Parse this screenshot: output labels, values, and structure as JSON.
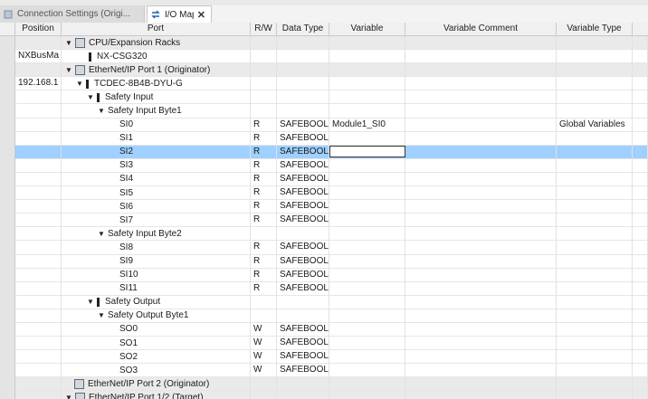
{
  "tabs": [
    {
      "label": "Connection Settings (Origi...",
      "active": false
    },
    {
      "label": "I/O Map",
      "active": true,
      "close": "✕"
    }
  ],
  "columns": {
    "position": "Position",
    "port": "Port",
    "rw": "R/W",
    "type": "Data Type",
    "variable": "Variable",
    "comment": "Variable Comment",
    "vtype": "Variable Type"
  },
  "rows": [
    {
      "position": "",
      "port": "CPU/Expansion Racks",
      "rw": "",
      "type": "",
      "variable": "",
      "vtype": "",
      "group": true,
      "tri": "▼",
      "icon": "rack"
    },
    {
      "position": "NXBusMa",
      "port": "NX-CSG320",
      "rw": "",
      "type": "",
      "variable": "",
      "vtype": "",
      "group": false,
      "tri": "",
      "icon": "device"
    },
    {
      "position": "",
      "port": "EtherNet/IP Port 1 (Originator)",
      "rw": "",
      "type": "",
      "variable": "",
      "vtype": "",
      "group": true,
      "tri": "▼",
      "icon": "rack"
    },
    {
      "position": "192.168.1",
      "port": "TCDEC-8B4B-DYU-G",
      "rw": "",
      "type": "",
      "variable": "",
      "vtype": "",
      "group": false,
      "tri": "▼",
      "icon": "device"
    },
    {
      "position": "",
      "port": "Safety Input",
      "rw": "",
      "type": "",
      "variable": "",
      "vtype": "",
      "group": false,
      "tri": "▼",
      "icon": "device"
    },
    {
      "position": "",
      "port": "Safety Input Byte1",
      "rw": "",
      "type": "",
      "variable": "",
      "vtype": "",
      "group": false,
      "tri": "▼",
      "icon": ""
    },
    {
      "position": "",
      "port": "SI0",
      "rw": "R",
      "type": "SAFEBOOL",
      "variable": "Module1_SI0",
      "vtype": "Global Variables",
      "group": false,
      "tri": "",
      "icon": ""
    },
    {
      "position": "",
      "port": "SI1",
      "rw": "R",
      "type": "SAFEBOOL",
      "variable": "",
      "vtype": "",
      "group": false,
      "tri": "",
      "icon": ""
    },
    {
      "position": "",
      "port": "SI2",
      "rw": "R",
      "type": "SAFEBOOL",
      "variable": "",
      "vtype": "",
      "group": false,
      "tri": "",
      "icon": "",
      "selected": true
    },
    {
      "position": "",
      "port": "SI3",
      "rw": "R",
      "type": "SAFEBOOL",
      "variable": "",
      "vtype": "",
      "group": false,
      "tri": "",
      "icon": ""
    },
    {
      "position": "",
      "port": "SI4",
      "rw": "R",
      "type": "SAFEBOOL",
      "variable": "",
      "vtype": "",
      "group": false,
      "tri": "",
      "icon": ""
    },
    {
      "position": "",
      "port": "SI5",
      "rw": "R",
      "type": "SAFEBOOL",
      "variable": "",
      "vtype": "",
      "group": false,
      "tri": "",
      "icon": ""
    },
    {
      "position": "",
      "port": "SI6",
      "rw": "R",
      "type": "SAFEBOOL",
      "variable": "",
      "vtype": "",
      "group": false,
      "tri": "",
      "icon": ""
    },
    {
      "position": "",
      "port": "SI7",
      "rw": "R",
      "type": "SAFEBOOL",
      "variable": "",
      "vtype": "",
      "group": false,
      "tri": "",
      "icon": ""
    },
    {
      "position": "",
      "port": "Safety Input Byte2",
      "rw": "",
      "type": "",
      "variable": "",
      "vtype": "",
      "group": false,
      "tri": "▼",
      "icon": ""
    },
    {
      "position": "",
      "port": "SI8",
      "rw": "R",
      "type": "SAFEBOOL",
      "variable": "",
      "vtype": "",
      "group": false,
      "tri": "",
      "icon": ""
    },
    {
      "position": "",
      "port": "SI9",
      "rw": "R",
      "type": "SAFEBOOL",
      "variable": "",
      "vtype": "",
      "group": false,
      "tri": "",
      "icon": ""
    },
    {
      "position": "",
      "port": "SI10",
      "rw": "R",
      "type": "SAFEBOOL",
      "variable": "",
      "vtype": "",
      "group": false,
      "tri": "",
      "icon": ""
    },
    {
      "position": "",
      "port": "SI11",
      "rw": "R",
      "type": "SAFEBOOL",
      "variable": "",
      "vtype": "",
      "group": false,
      "tri": "",
      "icon": ""
    },
    {
      "position": "",
      "port": "Safety Output",
      "rw": "",
      "type": "",
      "variable": "",
      "vtype": "",
      "group": false,
      "tri": "▼",
      "icon": "device"
    },
    {
      "position": "",
      "port": "Safety Output Byte1",
      "rw": "",
      "type": "",
      "variable": "",
      "vtype": "",
      "group": false,
      "tri": "▼",
      "icon": ""
    },
    {
      "position": "",
      "port": "SO0",
      "rw": "W",
      "type": "SAFEBOOL",
      "variable": "",
      "vtype": "",
      "group": false,
      "tri": "",
      "icon": ""
    },
    {
      "position": "",
      "port": "SO1",
      "rw": "W",
      "type": "SAFEBOOL",
      "variable": "",
      "vtype": "",
      "group": false,
      "tri": "",
      "icon": ""
    },
    {
      "position": "",
      "port": "SO2",
      "rw": "W",
      "type": "SAFEBOOL",
      "variable": "",
      "vtype": "",
      "group": false,
      "tri": "",
      "icon": ""
    },
    {
      "position": "",
      "port": "SO3",
      "rw": "W",
      "type": "SAFEBOOL",
      "variable": "",
      "vtype": "",
      "group": false,
      "tri": "",
      "icon": ""
    },
    {
      "position": "",
      "port": "EtherNet/IP Port 2 (Originator)",
      "rw": "",
      "type": "",
      "variable": "",
      "vtype": "",
      "group": true,
      "tri": "",
      "icon": "rack"
    },
    {
      "position": "",
      "port": "EtherNet/IP Port 1/2 (Target)",
      "rw": "",
      "type": "",
      "variable": "",
      "vtype": "",
      "group": true,
      "tri": "▼",
      "icon": "rack"
    }
  ],
  "colors": {
    "selected_row": "#9fd0ff",
    "group_row": "#eaeaea",
    "header": "#f0f0f0"
  },
  "icons": {
    "tab_settings": "settings-doc-icon",
    "tab_iomap": "swap-arrows-icon",
    "rack": "rack-icon",
    "device": "device-bar-icon"
  }
}
